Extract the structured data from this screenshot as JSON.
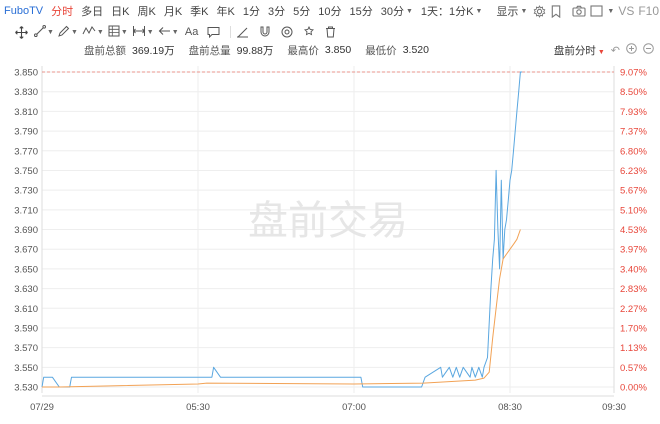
{
  "toolbar": {
    "symbol": "FuboTV",
    "periods": [
      "分时",
      "多日",
      "日K",
      "周K",
      "月K",
      "季K",
      "年K",
      "1分",
      "3分",
      "5分",
      "10分",
      "15分",
      "30分"
    ],
    "active_period": "分时",
    "interval_select": "1天：1分K",
    "display_label": "显示",
    "vs_label": "VS",
    "f10_label": "F10"
  },
  "drawing_tools": [
    "move-icon",
    "line-icon",
    "pen-icon",
    "wave-icon",
    "grid-icon",
    "range-icon",
    "arrow-icon",
    "text-icon",
    "comment-icon",
    "ruler-icon",
    "magnet-icon",
    "eye-icon",
    "lock-icon",
    "trash-icon",
    "undo-icon"
  ],
  "info": {
    "amount_label": "盘前总额",
    "amount_value": "369.19万",
    "volume_label": "盘前总量",
    "volume_value": "99.88万",
    "high_label": "最高价",
    "high_value": "3.850",
    "low_label": "最低价",
    "low_value": "3.520",
    "mode_label": "盘前分时"
  },
  "colors": {
    "price_line": "#5aa7e0",
    "avg_line": "#f2a255",
    "up": "#e8463a",
    "grid": "#eeeeee",
    "watermark": "#e6e6e6",
    "accent": "#e8463a"
  },
  "chart_data": {
    "type": "line",
    "watermark": "盘前交易",
    "y_ticks": [
      "3.850",
      "3.830",
      "3.810",
      "3.790",
      "3.770",
      "3.750",
      "3.730",
      "3.710",
      "3.690",
      "3.670",
      "3.650",
      "3.630",
      "3.610",
      "3.590",
      "3.570",
      "3.550",
      "3.530"
    ],
    "pct_ticks": [
      "9.07%",
      "8.50%",
      "7.93%",
      "7.37%",
      "6.80%",
      "6.23%",
      "5.67%",
      "5.10%",
      "4.53%",
      "3.97%",
      "3.40%",
      "2.83%",
      "2.27%",
      "1.70%",
      "1.13%",
      "0.57%",
      "0.00%"
    ],
    "x_ticks": [
      "07/29",
      "05:30",
      "07:00",
      "08:30",
      "09:30"
    ],
    "ylim": [
      3.53,
      3.85
    ],
    "x_range_minutes": [
      240,
      570
    ],
    "x_tick_minutes": [
      240,
      330,
      420,
      510,
      570
    ],
    "high_reference": 3.85,
    "series": [
      {
        "name": "",
        "x": [
          240,
          241,
          242,
          246,
          250,
          256,
          257,
          338,
          339,
          343,
          424,
          425,
          434,
          459,
          461,
          470,
          471,
          475,
          477,
          479,
          481,
          483,
          487,
          488,
          490,
          492,
          494,
          495,
          497,
          499,
          500,
          501,
          502,
          503,
          504,
          505,
          506,
          507,
          508,
          509,
          510,
          511,
          512,
          513,
          514,
          515,
          516,
          517
        ],
        "y": [
          3.53,
          3.54,
          3.54,
          3.54,
          3.53,
          3.53,
          3.54,
          3.54,
          3.55,
          3.54,
          3.54,
          3.53,
          3.53,
          3.53,
          3.54,
          3.55,
          3.54,
          3.55,
          3.54,
          3.55,
          3.54,
          3.55,
          3.54,
          3.55,
          3.54,
          3.55,
          3.54,
          3.55,
          3.56,
          3.63,
          3.66,
          3.68,
          3.75,
          3.69,
          3.65,
          3.74,
          3.66,
          3.69,
          3.7,
          3.72,
          3.74,
          3.75,
          3.77,
          3.79,
          3.81,
          3.83,
          3.85,
          3.85
        ]
      },
      {
        "name": "",
        "x": [
          240,
          250,
          330,
          335,
          420,
          460,
          470,
          480,
          490,
          495,
          498,
          500,
          502,
          504,
          506,
          508,
          510,
          512,
          514,
          516
        ],
        "y": [
          3.53,
          3.53,
          3.533,
          3.534,
          3.533,
          3.534,
          3.535,
          3.536,
          3.537,
          3.539,
          3.545,
          3.58,
          3.61,
          3.64,
          3.66,
          3.665,
          3.67,
          3.675,
          3.68,
          3.69
        ]
      }
    ]
  }
}
